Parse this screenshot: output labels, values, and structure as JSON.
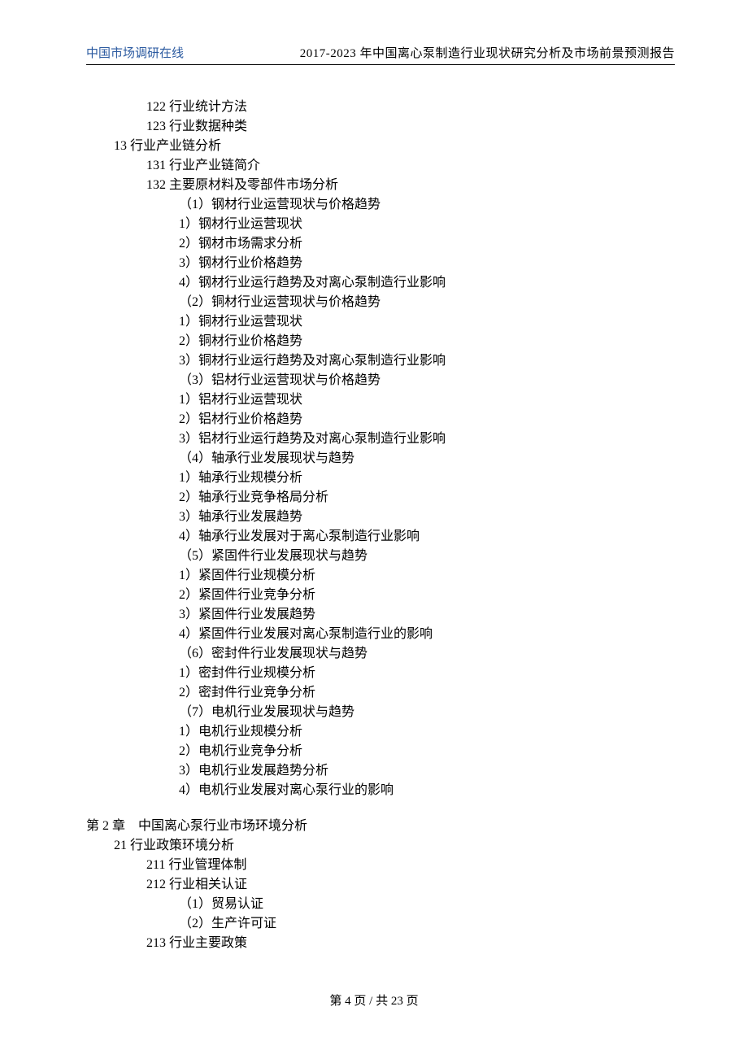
{
  "header": {
    "left": "中国市场调研在线",
    "right": "2017-2023 年中国离心泵制造行业现状研究分析及市场前景预测报告"
  },
  "lines": [
    {
      "cls": "lv3",
      "t": "122 行业统计方法"
    },
    {
      "cls": "lv3",
      "t": "123 行业数据种类"
    },
    {
      "cls": "lv2",
      "t": "13 行业产业链分析"
    },
    {
      "cls": "lv3",
      "t": "131 行业产业链简介"
    },
    {
      "cls": "lv3",
      "t": "132 主要原材料及零部件市场分析"
    },
    {
      "cls": "lv4",
      "t": "（1）钢材行业运营现状与价格趋势"
    },
    {
      "cls": "lv4",
      "t": "1）钢材行业运营现状"
    },
    {
      "cls": "lv4",
      "t": "2）钢材市场需求分析"
    },
    {
      "cls": "lv4",
      "t": "3）钢材行业价格趋势"
    },
    {
      "cls": "lv4",
      "t": "4）钢材行业运行趋势及对离心泵制造行业影响"
    },
    {
      "cls": "lv4",
      "t": "（2）铜材行业运营现状与价格趋势"
    },
    {
      "cls": "lv4",
      "t": "1）铜材行业运营现状"
    },
    {
      "cls": "lv4",
      "t": "2）铜材行业价格趋势"
    },
    {
      "cls": "lv4",
      "t": "3）铜材行业运行趋势及对离心泵制造行业影响"
    },
    {
      "cls": "lv4",
      "t": "（3）铝材行业运营现状与价格趋势"
    },
    {
      "cls": "lv4",
      "t": "1）铝材行业运营现状"
    },
    {
      "cls": "lv4",
      "t": "2）铝材行业价格趋势"
    },
    {
      "cls": "lv4",
      "t": "3）铝材行业运行趋势及对离心泵制造行业影响"
    },
    {
      "cls": "lv4",
      "t": "（4）轴承行业发展现状与趋势"
    },
    {
      "cls": "lv4",
      "t": "1）轴承行业规模分析"
    },
    {
      "cls": "lv4",
      "t": "2）轴承行业竞争格局分析"
    },
    {
      "cls": "lv4",
      "t": "3）轴承行业发展趋势"
    },
    {
      "cls": "lv4",
      "t": "4）轴承行业发展对于离心泵制造行业影响"
    },
    {
      "cls": "lv4",
      "t": "（5）紧固件行业发展现状与趋势"
    },
    {
      "cls": "lv4",
      "t": "1）紧固件行业规模分析"
    },
    {
      "cls": "lv4",
      "t": "2）紧固件行业竞争分析"
    },
    {
      "cls": "lv4",
      "t": "3）紧固件行业发展趋势"
    },
    {
      "cls": "lv4",
      "t": "4）紧固件行业发展对离心泵制造行业的影响"
    },
    {
      "cls": "lv4",
      "t": "（6）密封件行业发展现状与趋势"
    },
    {
      "cls": "lv4",
      "t": "1）密封件行业规模分析"
    },
    {
      "cls": "lv4",
      "t": "2）密封件行业竞争分析"
    },
    {
      "cls": "lv4",
      "t": "（7）电机行业发展现状与趋势"
    },
    {
      "cls": "lv4",
      "t": "1）电机行业规模分析"
    },
    {
      "cls": "lv4",
      "t": "2）电机行业竞争分析"
    },
    {
      "cls": "lv4",
      "t": "3）电机行业发展趋势分析"
    },
    {
      "cls": "lv4",
      "t": "4）电机行业发展对离心泵行业的影响"
    },
    {
      "cls": "chapter",
      "t": "第 2 章　中国离心泵行业市场环境分析"
    },
    {
      "cls": "lv2",
      "t": "21 行业政策环境分析"
    },
    {
      "cls": "lv3",
      "t": "211 行业管理体制"
    },
    {
      "cls": "lv3",
      "t": "212 行业相关认证"
    },
    {
      "cls": "lv5",
      "t": "（1）贸易认证"
    },
    {
      "cls": "lv5",
      "t": "（2）生产许可证"
    },
    {
      "cls": "lv3",
      "t": "213 行业主要政策"
    }
  ],
  "footer": {
    "page_label": "第 4 页 / 共 23 页"
  }
}
